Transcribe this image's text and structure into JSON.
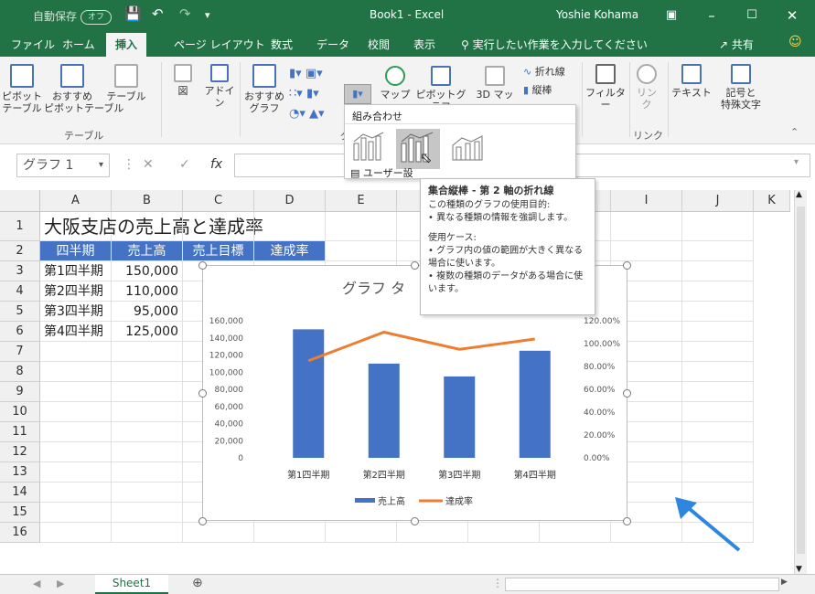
{
  "title_bar": {
    "autosave_label": "自動保存",
    "autosave_state": "オフ",
    "doc_title": "Book1 - Excel",
    "user": "Yoshie Kohama"
  },
  "tabs": [
    "ファイル",
    "ホーム",
    "挿入",
    "ページ レイアウト",
    "数式",
    "データ",
    "校閲",
    "表示"
  ],
  "active_tab": "挿入",
  "tell_me": "実行したい作業を入力してください",
  "share": "共有",
  "ribbon": {
    "pivot": "ピボット\nテーブル",
    "recommended_pivot": "おすすめ\nピボットテーブル",
    "table": "テーブル",
    "table_group": "テーブル",
    "illustrations": "図",
    "addins": "アドイ\nン",
    "recommended_charts": "おすすめ\nグラフ",
    "map": "マップ",
    "pivotchart": "ピボットグラフ",
    "map3d": "3D マッ",
    "sparkline_line": "折れ線",
    "sparkline_col": "縦棒",
    "filter": "フィルター",
    "link": "リン\nク",
    "link_group": "リンク",
    "text": "テキスト",
    "symbols": "記号と\n特殊文字",
    "chart_group": "グ"
  },
  "formula_bar": {
    "name_box": "グラフ 1",
    "fx": "fx"
  },
  "columns": [
    "A",
    "B",
    "C",
    "D",
    "E",
    "F",
    "G",
    "H",
    "I",
    "J",
    "K"
  ],
  "rows": [
    "1",
    "2",
    "3",
    "4",
    "5",
    "6",
    "7",
    "8",
    "9",
    "10",
    "11",
    "12",
    "13",
    "14",
    "15",
    "16"
  ],
  "sheet": {
    "title": "大阪支店の売上高と達成率",
    "headers": [
      "四半期",
      "売上高",
      "売上目標",
      "達成率"
    ],
    "data": [
      {
        "q": "第1四半期",
        "sales": "150,000"
      },
      {
        "q": "第2四半期",
        "sales": "110,000"
      },
      {
        "q": "第3四半期",
        "sales": "95,000"
      },
      {
        "q": "第4四半期",
        "sales": "125,000"
      }
    ]
  },
  "dropdown": {
    "header": "組み合わせ",
    "custom": "ユーザー設"
  },
  "tooltip": {
    "title": "集合縦棒 - 第 2 軸の折れ線",
    "purpose_head": "この種類のグラフの使用目的:",
    "purpose_1": "• 異なる種類の情報を強調します。",
    "usage_head": "使用ケース:",
    "usage_1": "• グラフ内の値の範囲が大きく異なる場合に使います。",
    "usage_2": "• 複数の種類のデータがある場合に使います。"
  },
  "sheet_tab": "Sheet1",
  "colors": {
    "excel_green": "#217346",
    "header_blue": "#4472c4",
    "bar_blue": "#4472c4",
    "line_orange": "#ed7d31",
    "arrow_blue": "#2e86de"
  },
  "chart_data": {
    "type": "bar",
    "title": "グラフ タ",
    "categories": [
      "第1四半期",
      "第2四半期",
      "第3四半期",
      "第4四半期"
    ],
    "series": [
      {
        "name": "売上高",
        "type": "bar",
        "axis": "left",
        "values": [
          150000,
          110000,
          95000,
          125000
        ]
      },
      {
        "name": "達成率",
        "type": "line",
        "axis": "right",
        "values": [
          0.85,
          1.1,
          0.95,
          1.04
        ]
      }
    ],
    "y_left": {
      "min": 0,
      "max": 160000,
      "ticks": [
        "0",
        "20,000",
        "40,000",
        "60,000",
        "80,000",
        "100,000",
        "120,000",
        "140,000",
        "160,000"
      ]
    },
    "y_right": {
      "min": 0,
      "max": 1.2,
      "ticks": [
        "0.00%",
        "20.00%",
        "40.00%",
        "60.00%",
        "80.00%",
        "100.00%",
        "120.00%"
      ]
    },
    "legend_position": "bottom",
    "grid": false
  }
}
